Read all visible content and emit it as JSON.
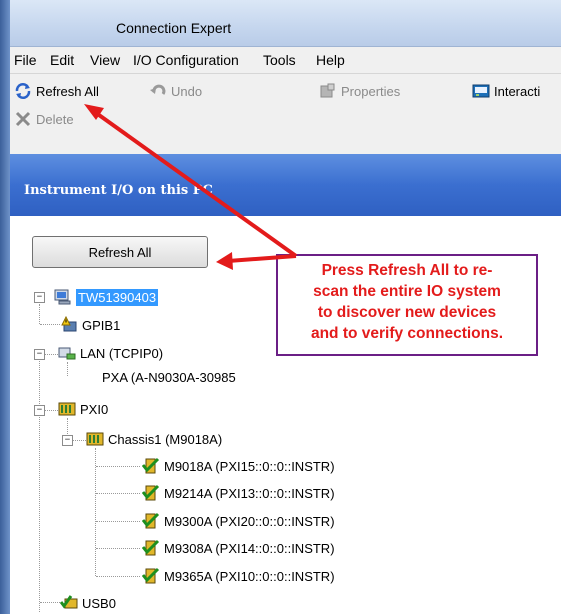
{
  "window": {
    "title": "Connection Expert"
  },
  "menu": [
    "File",
    "Edit",
    "View",
    "I/O Configuration",
    "Tools",
    "Help"
  ],
  "toolbar": {
    "refresh_all": "Refresh All",
    "undo": "Undo",
    "properties": "Properties",
    "interactive": "Interacti",
    "delete": "Delete"
  },
  "banner": {
    "title": "Instrument I/O on this PC"
  },
  "panel": {
    "refresh_button": "Refresh All"
  },
  "tree": {
    "root": "TW51390403",
    "gpib": "GPIB1",
    "lan": "LAN (TCPIP0)",
    "pxa": "PXA (A-N9030A-30985",
    "pxi": "PXI0",
    "chassis": "Chassis1 (M9018A)",
    "modules": [
      "M9018A (PXI15::0::0::INSTR)",
      "M9214A (PXI13::0::0::INSTR)",
      "M9300A (PXI20::0::0::INSTR)",
      "M9308A (PXI14::0::0::INSTR)",
      "M9365A (PXI10::0::0::INSTR)"
    ],
    "usb": "USB0"
  },
  "callout": {
    "lines": [
      "Press Refresh All to re-",
      "scan the entire IO system",
      "to discover new devices",
      "and to verify connections."
    ]
  },
  "colors": {
    "annotation": "#e31b1b",
    "callout_border": "#6b1f86",
    "banner": "#3b6fd0",
    "selection": "#3399ff"
  }
}
